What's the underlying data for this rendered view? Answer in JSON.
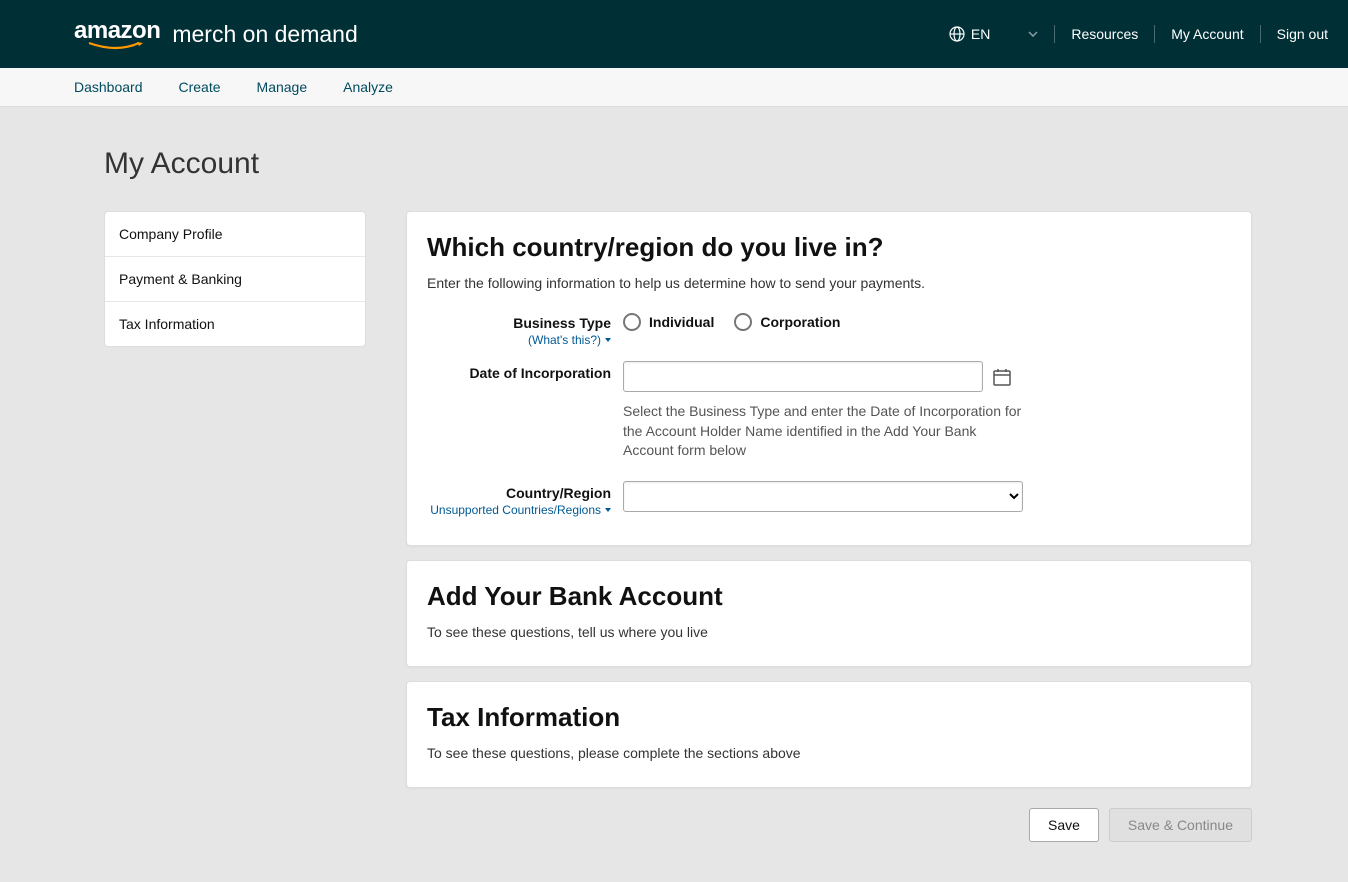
{
  "header": {
    "logo_main": "amazon",
    "logo_sub": "merch on demand",
    "language": "EN",
    "links": {
      "resources": "Resources",
      "my_account": "My Account",
      "sign_out": "Sign out"
    }
  },
  "nav": {
    "dashboard": "Dashboard",
    "create": "Create",
    "manage": "Manage",
    "analyze": "Analyze"
  },
  "page_title": "My Account",
  "sidebar": {
    "items": [
      {
        "label": "Company Profile"
      },
      {
        "label": "Payment & Banking"
      },
      {
        "label": "Tax Information"
      }
    ]
  },
  "card1": {
    "title": "Which country/region do you live in?",
    "subtitle": "Enter the following information to help us determine how to send your payments.",
    "business_type_label": "Business Type",
    "whats_this": "(What's this?)",
    "radio_individual": "Individual",
    "radio_corporation": "Corporation",
    "date_label": "Date of Incorporation",
    "date_help": "Select the Business Type and enter the Date of Incorporation for the Account Holder Name identified in the Add Your Bank Account form below",
    "country_label": "Country/Region",
    "unsupported_link": "Unsupported Countries/Regions"
  },
  "card2": {
    "title": "Add Your Bank Account",
    "subtitle": "To see these questions, tell us where you live"
  },
  "card3": {
    "title": "Tax Information",
    "subtitle": "To see these questions, please complete the sections above"
  },
  "buttons": {
    "save": "Save",
    "save_continue": "Save & Continue"
  }
}
